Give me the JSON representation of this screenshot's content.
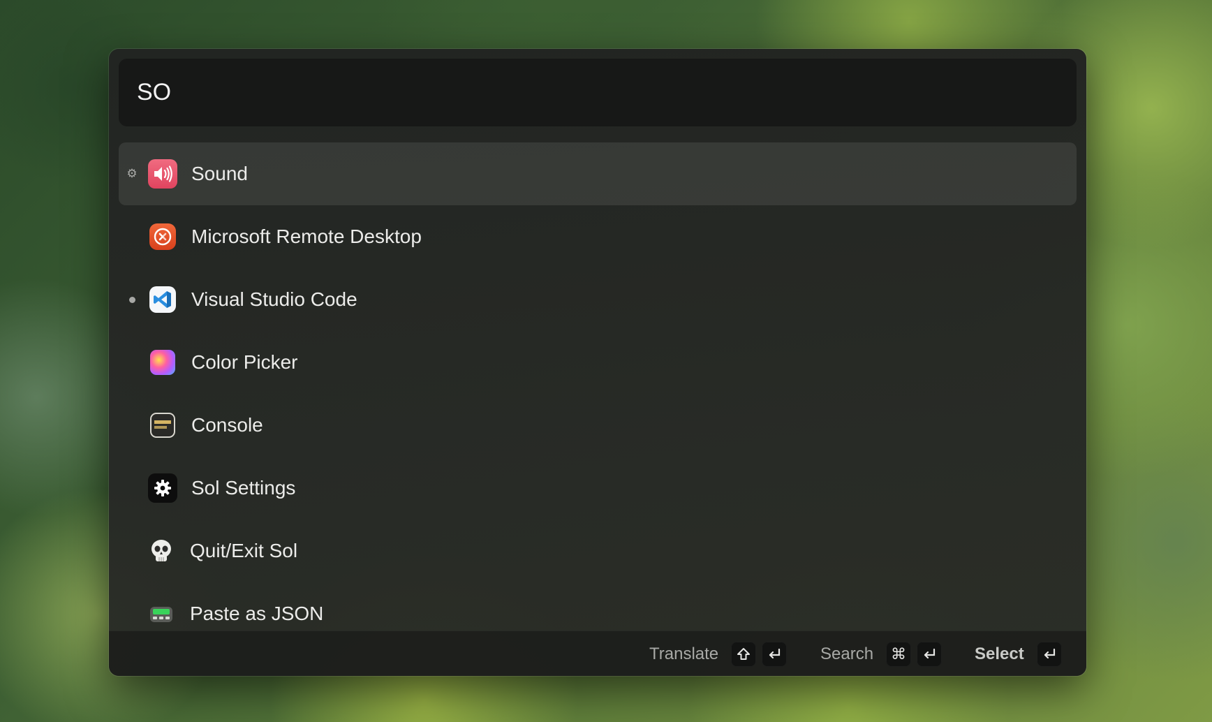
{
  "search": {
    "value": "SO"
  },
  "results": [
    {
      "label": "Sound",
      "icon": "sound-icon",
      "indicator": "gear",
      "selected": true,
      "icon_color": "#e8506a"
    },
    {
      "label": "Microsoft Remote Desktop",
      "icon": "remote-desktop-icon",
      "indicator": "none",
      "icon_color": "#e24b26"
    },
    {
      "label": "Visual Studio Code",
      "icon": "vscode-icon",
      "indicator": "dot",
      "icon_color": "#1f8ad2"
    },
    {
      "label": "Color Picker",
      "icon": "color-picker-icon",
      "indicator": "none"
    },
    {
      "label": "Console",
      "icon": "console-icon",
      "indicator": "none"
    },
    {
      "label": "Sol Settings",
      "icon": "settings-gear-icon",
      "indicator": "none"
    },
    {
      "label": "Quit/Exit Sol",
      "icon": "skull-icon",
      "indicator": "none"
    },
    {
      "label": "Paste as JSON",
      "icon": "clipboard-json-icon",
      "indicator": "none"
    }
  ],
  "footer": {
    "translate_label": "Translate",
    "translate_keys": [
      "shift-key-icon",
      "return-key-icon"
    ],
    "search_label": "Search",
    "search_keys": [
      "command-key-icon",
      "return-key-icon"
    ],
    "select_label": "Select",
    "select_keys": [
      "return-key-icon"
    ],
    "command_glyph": "⌘"
  }
}
